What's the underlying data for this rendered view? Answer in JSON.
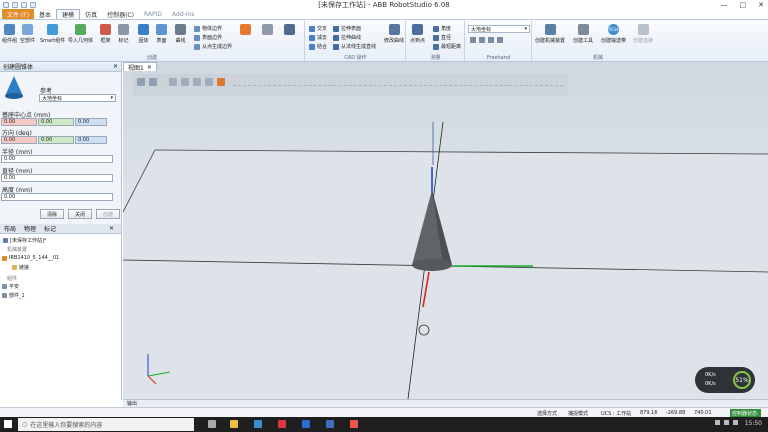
{
  "app": {
    "title": "[未保存工作站] - ABB RobotStudio 6.08"
  },
  "tabs": [
    "文件 (F)",
    "基本",
    "建模",
    "仿真",
    "控制器(C)",
    "RAPID",
    "Add-Ins"
  ],
  "ribbon": {
    "create": {
      "label": "创建",
      "items": [
        "组件组",
        "空部件",
        "Smart组件",
        "导入几何体",
        "框架",
        "标记",
        "固体",
        "表面",
        "曲线"
      ],
      "small": [
        "物体边界",
        "表面边界",
        "从点生成边界"
      ]
    },
    "cad": {
      "label": "CAD 操作",
      "items": [
        "交叉",
        "减去",
        "结合",
        "拉伸表面",
        "拉伸曲线",
        "从法线生成直线",
        "修改曲线"
      ]
    },
    "measure": {
      "label": "测量",
      "items": [
        "点到点",
        "角度",
        "直径",
        "最短距离"
      ]
    },
    "freehand": {
      "label": "Freehand",
      "combo": "大地坐标"
    },
    "mech": {
      "label": "机械",
      "items": [
        "创建机械装置",
        "创建工具",
        "创建输送带",
        "创建连接"
      ]
    },
    "badge": "9534"
  },
  "panel": {
    "title": "创建圆锥体",
    "ref_label": "参考",
    "ref_value": "大地坐标",
    "center_label": "基座中心点 (mm)",
    "center": [
      "0.00",
      "0.00",
      "0.00"
    ],
    "dir_label": "方向 (deg)",
    "dir": [
      "0.00",
      "0.00",
      "0.00"
    ],
    "radius_label": "半径 (mm)",
    "radius": "0.00",
    "diam_label": "直径 (mm)",
    "diam": "0.00",
    "height_label": "高度 (mm)",
    "height": "0.00",
    "btn_clear": "清除",
    "btn_close": "关闭",
    "btn_create": "创建"
  },
  "tree": {
    "tabs": [
      "布局",
      "物理",
      "标记"
    ],
    "station": "[未保存工作站]*",
    "mech_header": "机械装置",
    "robot": "IRB1410_5_144__01",
    "links": "链接",
    "parts_header": "组件",
    "part1": "平安",
    "part2": "部件_1"
  },
  "viewport": {
    "tab": "视图1"
  },
  "hud": {
    "val1": "0K/s",
    "val2": "0K/s",
    "percent": "51%"
  },
  "output": {
    "label": "输出"
  },
  "status": {
    "mode": "选择方式",
    "snap": "捕捉模式",
    "ucs": "UCS : 工作站",
    "x": "879.16",
    "y": "-269.88",
    "z": "740.01",
    "controller": "控制器状态:"
  },
  "taskbar": {
    "search": "在这里输入你要搜索的内容",
    "time": "15:50"
  }
}
